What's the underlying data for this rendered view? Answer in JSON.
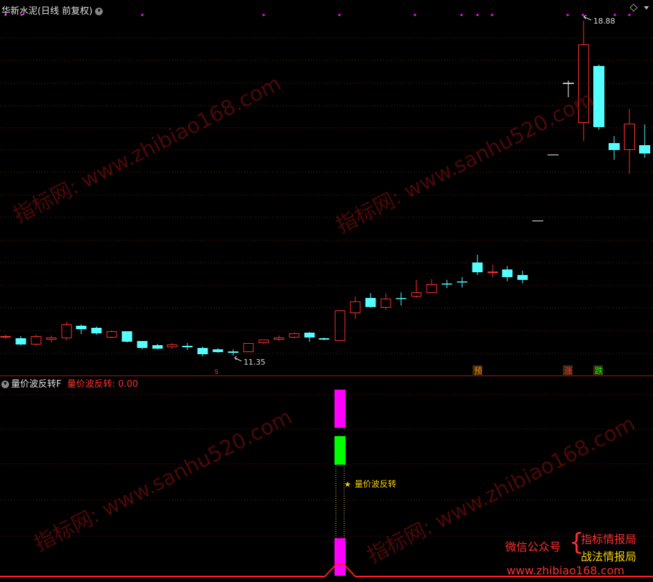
{
  "header": {
    "stock_title": "华新水泥(日线 前复权)",
    "menu_icon": "chevron-down-icon",
    "diamond_icon": "diamond-icon"
  },
  "main_chart": {
    "high_label": "18.88",
    "low_label": "11.35",
    "signals": [
      {
        "text": "s",
        "color": "#ff3030"
      },
      {
        "text": "预",
        "color": "#ff8c00"
      },
      {
        "text": "涨",
        "color": "#ff3030"
      },
      {
        "text": "跌",
        "color": "#00ff00"
      }
    ]
  },
  "indicator": {
    "name": "量价波反转F",
    "value_label": "量价波反转: 0.00",
    "annotation": "量价波反转",
    "annotation_icon": "star-icon"
  },
  "watermarks": {
    "a": "指标网: www.zhibiao168.com",
    "b": "指标网: www.sanhu520.com"
  },
  "brand": {
    "wechat": "微信公众号",
    "line1": "指标情报局",
    "line2": "战法情报局",
    "url": "www.zhibiao168.com"
  },
  "colors": {
    "up": "#ff3030",
    "down": "#54ffff",
    "magenta": "#ff00ff",
    "green": "#00ff00",
    "grid": "#7a1a1a",
    "brand_red": "#ff3030",
    "brand_yellow": "#ffd700"
  }
}
